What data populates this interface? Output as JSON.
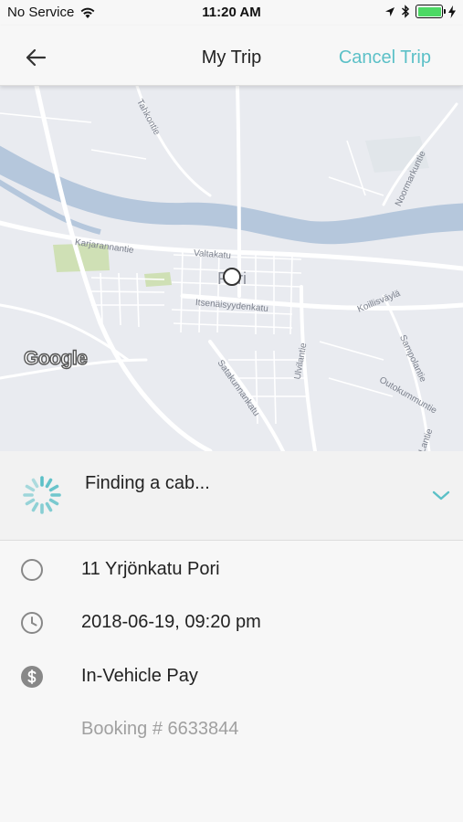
{
  "status_bar": {
    "carrier": "No Service",
    "time": "11:20 AM",
    "battery_level": 1.0,
    "battery_color": "#4cd964"
  },
  "nav": {
    "title": "My Trip",
    "cancel_label": "Cancel Trip",
    "accent_color": "#5bc0c7"
  },
  "map": {
    "city": "Pori",
    "streets": [
      "Karjarannantie",
      "Valtakatu",
      "Itsenäisyydenkatu",
      "Koillisväylä",
      "Ulvilantie",
      "Satakunnankatu",
      "Outokummuntie",
      "Noormarkuntie",
      "Sampolantie",
      "Lantie",
      "Tahkontie"
    ],
    "attribution": "Google"
  },
  "trip_status": {
    "text": "Finding a cab...",
    "icons": [
      "spinner-icon",
      "chevron-down-icon"
    ]
  },
  "details": {
    "address": "11 Yrjönkatu Pori",
    "datetime": "2018-06-19, 09:20 pm",
    "payment": "In-Vehicle Pay",
    "booking": "Booking # 6633844",
    "icons": [
      "circle-icon",
      "clock-icon",
      "dollar-icon"
    ]
  }
}
